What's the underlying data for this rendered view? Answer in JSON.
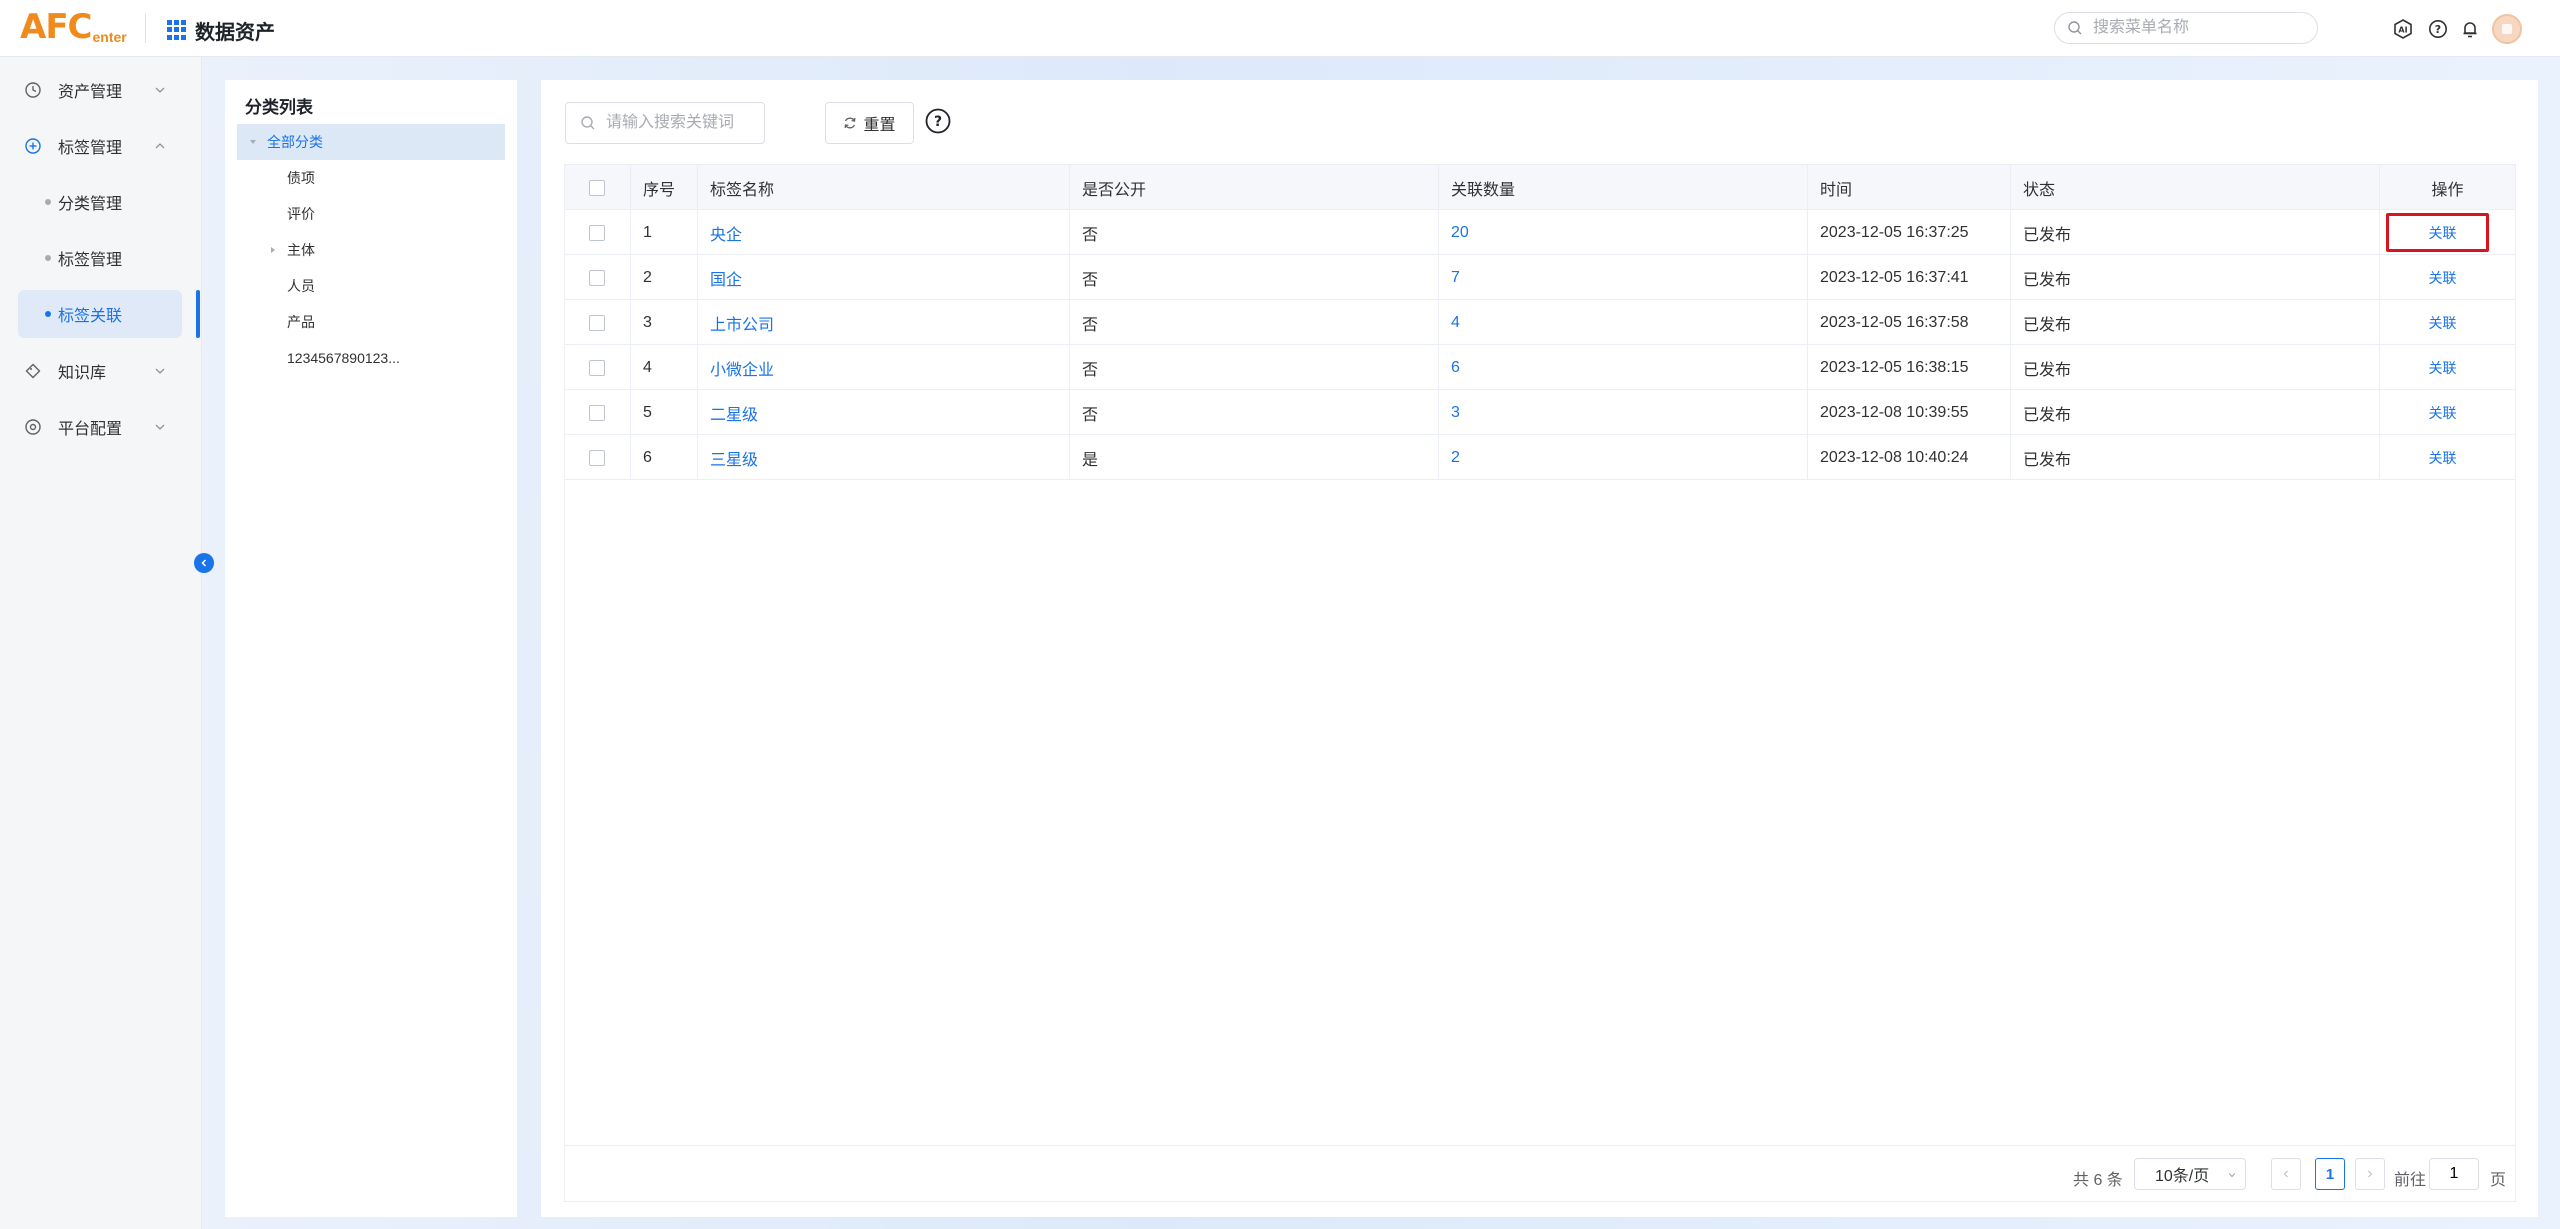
{
  "header": {
    "logo_main": "AFC",
    "logo_sub": "enter",
    "app_title": "数据资产",
    "search_placeholder": "搜索菜单名称"
  },
  "sidebar": {
    "items": [
      {
        "label": "资产管理",
        "icon": "clock-icon",
        "expanded": false
      },
      {
        "label": "标签管理",
        "icon": "plus-circle-icon",
        "expanded": true,
        "children": [
          {
            "label": "分类管理",
            "active": false
          },
          {
            "label": "标签管理",
            "active": false
          },
          {
            "label": "标签关联",
            "active": true
          }
        ]
      },
      {
        "label": "知识库",
        "icon": "tag-icon",
        "expanded": false
      },
      {
        "label": "平台配置",
        "icon": "target-icon",
        "expanded": false
      }
    ]
  },
  "category": {
    "title": "分类列表",
    "nodes": [
      {
        "label": "全部分类",
        "selected": true
      },
      {
        "label": "债项"
      },
      {
        "label": "评价"
      },
      {
        "label": "主体"
      },
      {
        "label": "人员"
      },
      {
        "label": "产品"
      },
      {
        "label": "1234567890123..."
      }
    ]
  },
  "toolbar": {
    "keyword_placeholder": "请输入搜索关键词",
    "reset_label": "重置"
  },
  "table": {
    "columns": [
      "序号",
      "标签名称",
      "是否公开",
      "关联数量",
      "时间",
      "状态",
      "操作"
    ],
    "rows": [
      {
        "index": "1",
        "name": "央企",
        "public": "否",
        "count": "20",
        "time": "2023-12-05 16:37:25",
        "status": "已发布",
        "op": "关联"
      },
      {
        "index": "2",
        "name": "国企",
        "public": "否",
        "count": "7",
        "time": "2023-12-05 16:37:41",
        "status": "已发布",
        "op": "关联"
      },
      {
        "index": "3",
        "name": "上市公司",
        "public": "否",
        "count": "4",
        "time": "2023-12-05 16:37:58",
        "status": "已发布",
        "op": "关联"
      },
      {
        "index": "4",
        "name": "小微企业",
        "public": "否",
        "count": "6",
        "time": "2023-12-05 16:38:15",
        "status": "已发布",
        "op": "关联"
      },
      {
        "index": "5",
        "name": "二星级",
        "public": "否",
        "count": "3",
        "time": "2023-12-08 10:39:55",
        "status": "已发布",
        "op": "关联"
      },
      {
        "index": "6",
        "name": "三星级",
        "public": "是",
        "count": "2",
        "time": "2023-12-08 10:40:24",
        "status": "已发布",
        "op": "关联"
      }
    ]
  },
  "pagination": {
    "total": "共 6 条",
    "page_size": "10条/页",
    "current": "1",
    "goto_prefix": "前往",
    "goto_value": "1",
    "goto_suffix": "页"
  },
  "colors": {
    "accent": "#1a73e8",
    "logo": "#f08a1c",
    "highlight": "#d9141f"
  }
}
